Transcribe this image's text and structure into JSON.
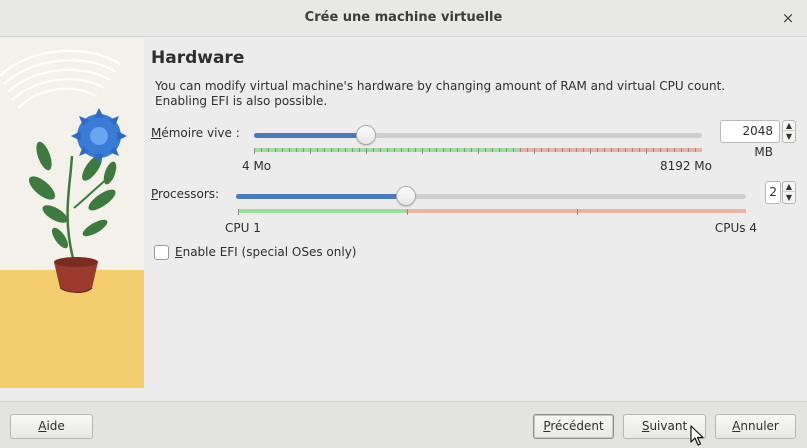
{
  "window": {
    "title": "Crée une machine virtuelle",
    "close_glyph": "×"
  },
  "page": {
    "heading": "Hardware",
    "description_line1": "You can modify virtual machine's hardware by changing amount of RAM and virtual CPU count.",
    "description_line2": "Enabling EFI is also possible."
  },
  "memory": {
    "label_accel": "M",
    "label_rest": "émoire vive :",
    "value": 2048,
    "value_text": "2048 MB",
    "min": 4,
    "max": 8192,
    "min_label": "4 Mo",
    "max_label": "8192 Mo",
    "recommended_fraction": 0.59
  },
  "processors": {
    "label_accel": "P",
    "label_rest": "rocessors:",
    "value": 2,
    "value_text": "2",
    "min": 1,
    "max": 4,
    "min_label": "CPU 1",
    "max_label": "CPUs 4",
    "recommended_fraction": 0.33
  },
  "efi": {
    "label_accel": "E",
    "label_rest": "nable EFI (special OSes only)",
    "checked": false
  },
  "buttons": {
    "help": {
      "accel": "A",
      "rest": "ide"
    },
    "back": {
      "accel": "P",
      "rest": "récédent"
    },
    "next": {
      "accel": "S",
      "rest": "uivant"
    },
    "cancel": {
      "accel": "A",
      "rest": "nnuler"
    }
  },
  "colors": {
    "accent": "#4a7ab8",
    "recommended": "#9fdb9f",
    "excess": "#e8b3a5"
  },
  "icons": {
    "close": "close-icon",
    "spin_up": "chevron-up-icon",
    "spin_down": "chevron-down-icon",
    "pointer": "mouse-pointer-icon",
    "illustration": "flower-pot-illustration"
  }
}
